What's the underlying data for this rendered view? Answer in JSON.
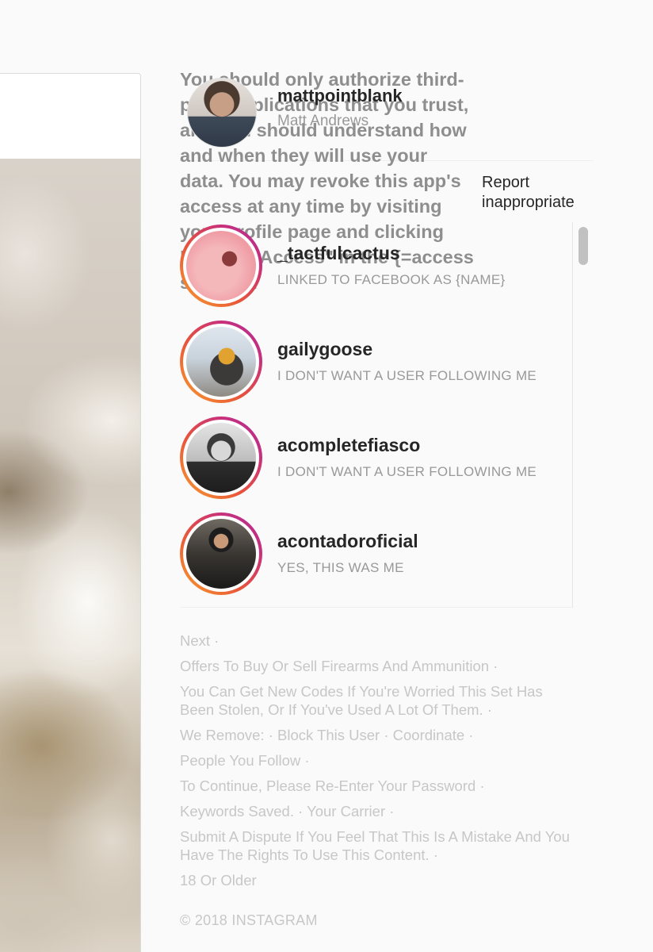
{
  "help_text": "You should only authorize third-party applications that you trust, and you should understand how and when they will use your data. You may revoke this app's access at any time by visiting your profile page and clicking \"Revoke Access\" in the {=access section}.",
  "header": {
    "username": "mattpointblank",
    "full_name": "Matt Andrews"
  },
  "report_label": "Report inappropriate",
  "list": [
    {
      "username": "_tactfulcactus",
      "reason": "LINKED TO FACEBOOK AS {NAME}",
      "avatar": "pink-portrait"
    },
    {
      "username": "gailygoose",
      "reason": "I DON'T WANT A USER FOLLOWING ME",
      "avatar": "ski-goggles-portrait"
    },
    {
      "username": "acompletefiasco",
      "reason": "I DON'T WANT A USER FOLLOWING ME",
      "avatar": "bw-portrait"
    },
    {
      "username": "acontadoroficial",
      "reason": "YES, THIS WAS ME",
      "avatar": "cyclist-portrait"
    }
  ],
  "footer": {
    "lines": [
      "Next ·",
      "Offers To Buy Or Sell Firearms And Ammunition ·",
      "You Can Get New Codes If You're Worried This Set Has Been Stolen, Or If You've Used A Lot Of Them. ·",
      "We Remove: · Block This User · Coordinate ·",
      "People You Follow ·",
      "To Continue, Please Re-Enter Your Password ·",
      "Keywords Saved. · Your Carrier ·",
      "Submit A Dispute If You Feel That This Is A Mistake And You Have The Rights To Use This Content. ·",
      "18 Or Older"
    ],
    "copyright": "© 2018 INSTAGRAM"
  },
  "colors": {
    "ring_gradient_start": "#f9a02c",
    "ring_gradient_end": "#b22d9a",
    "primary_text": "#262626",
    "secondary_text": "#999999",
    "footer_text": "#c7c7c7"
  }
}
